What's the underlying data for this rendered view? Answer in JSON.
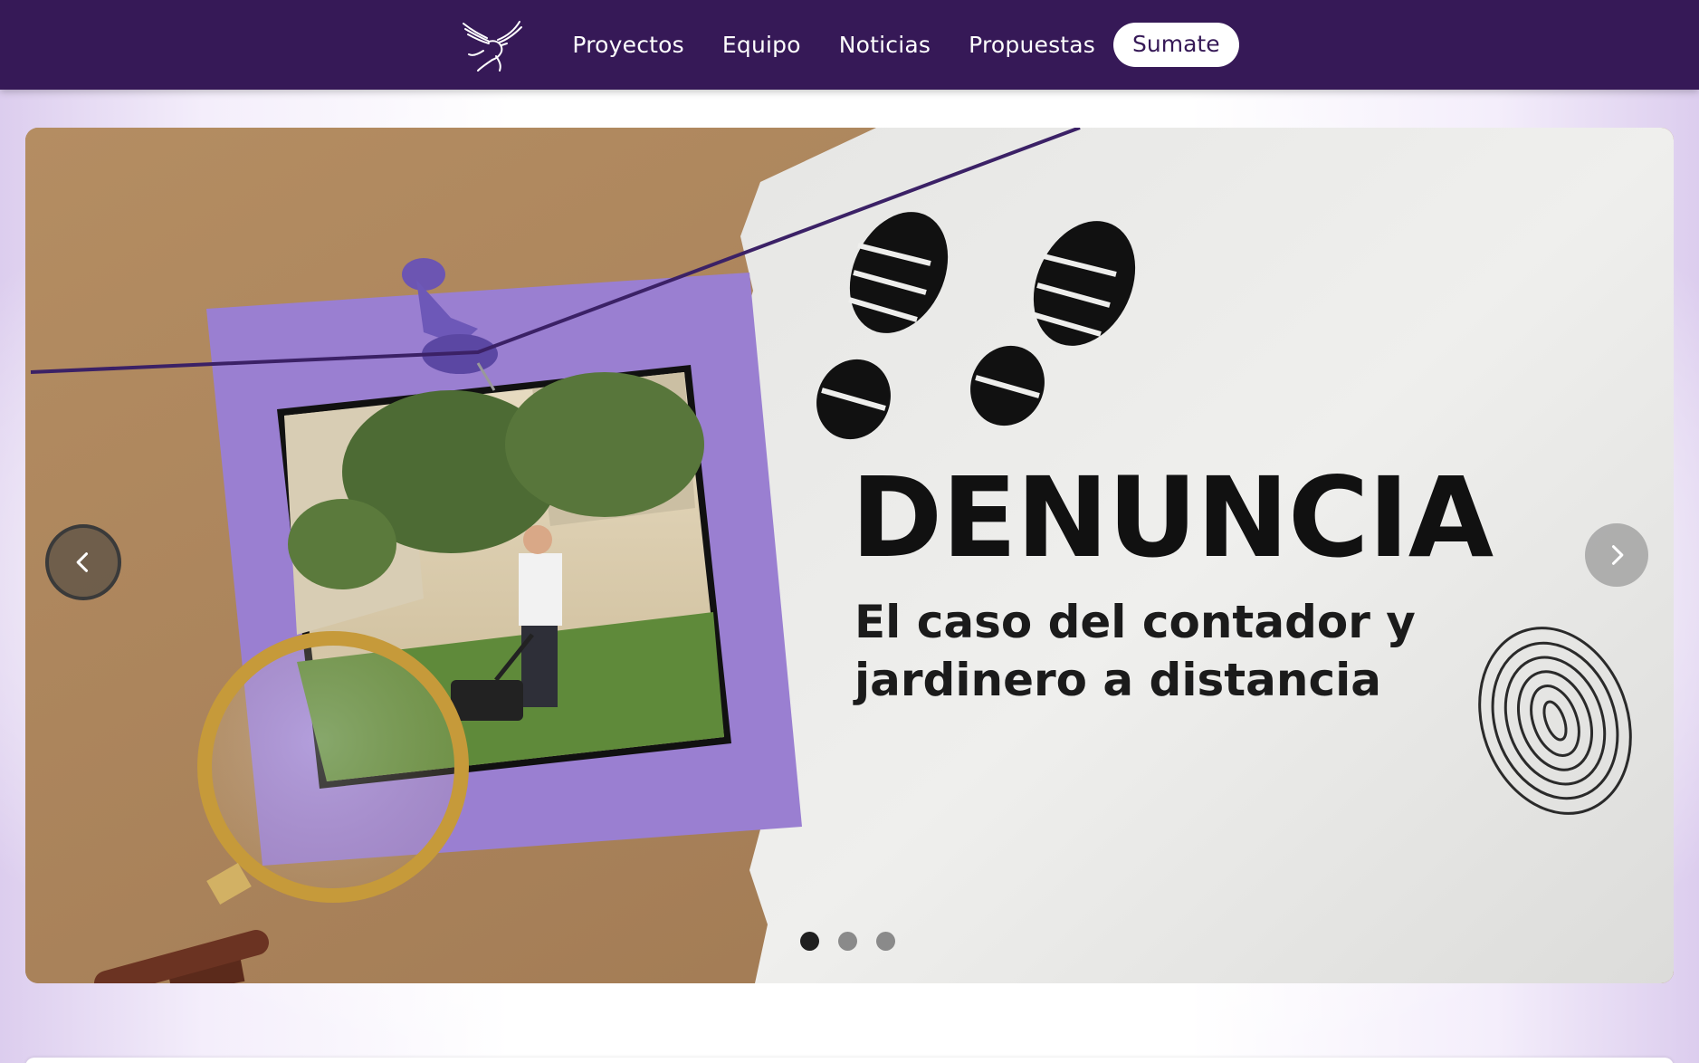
{
  "nav": {
    "logo_icon": "eagle-logo-icon",
    "links": [
      {
        "label": "Proyectos"
      },
      {
        "label": "Equipo"
      },
      {
        "label": "Noticias"
      },
      {
        "label": "Propuestas"
      }
    ],
    "cta_label": "Sumate"
  },
  "slider": {
    "title": "DENUNCIA",
    "subtitle": "El caso del contador y jardinero a distancia",
    "prev_icon": "chevron-left-icon",
    "next_icon": "chevron-right-icon",
    "dots_total": 3,
    "active_dot": 1
  },
  "colors": {
    "nav_background": "#361957",
    "accent_purple": "#9a7fd1",
    "cta_text": "#361957"
  }
}
